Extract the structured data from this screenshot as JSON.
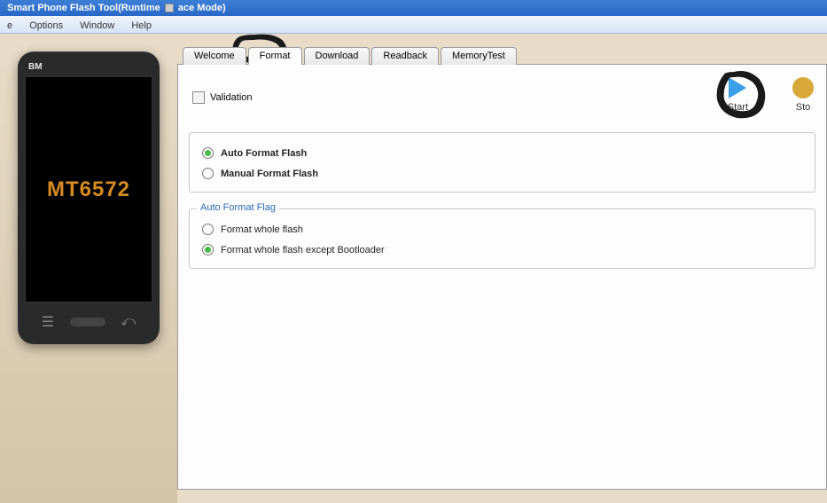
{
  "titlebar": {
    "text_left": "Smart Phone Flash Tool(Runtime",
    "text_right": "ace Mode)"
  },
  "menu": {
    "items": [
      "e",
      "Options",
      "Window",
      "Help"
    ]
  },
  "phone": {
    "brand": "BM",
    "model": "MT6572"
  },
  "tabs": {
    "items": [
      {
        "label": "Welcome",
        "active": false
      },
      {
        "label": "Format",
        "active": true
      },
      {
        "label": "Download",
        "active": false
      },
      {
        "label": "Readback",
        "active": false
      },
      {
        "label": "MemoryTest",
        "active": false
      }
    ]
  },
  "format": {
    "validation_label": "Validation",
    "validation_checked": false,
    "start_label": "Start",
    "stop_label": "Sto",
    "mode": {
      "auto_label": "Auto Format Flash",
      "manual_label": "Manual Format Flash",
      "selected": "auto"
    },
    "flag_section": {
      "legend": "Auto Format Flag",
      "whole_label": "Format whole flash",
      "except_label": "Format whole flash except Bootloader",
      "selected": "except"
    }
  }
}
